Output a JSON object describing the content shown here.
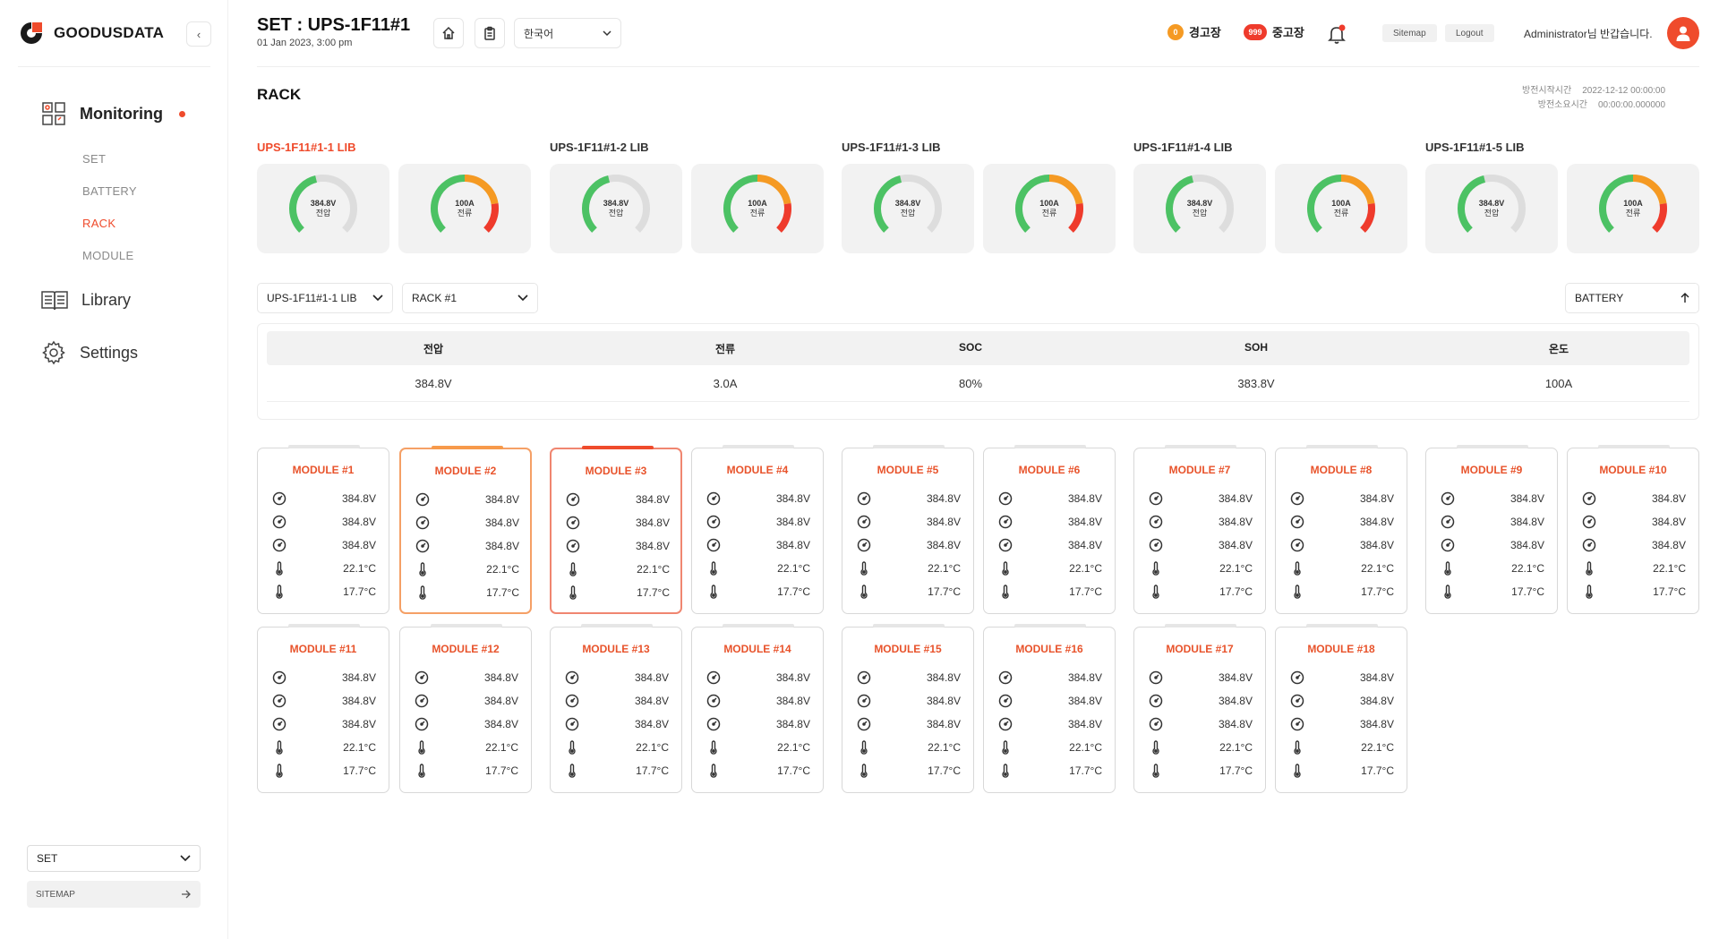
{
  "brand": {
    "name": "GOODUSDATA"
  },
  "sidebar": {
    "monitoring_label": "Monitoring",
    "sub_items": [
      {
        "label": "SET",
        "active": false
      },
      {
        "label": "BATTERY",
        "active": false
      },
      {
        "label": "RACK",
        "active": true
      },
      {
        "label": "MODULE",
        "active": false
      }
    ],
    "library_label": "Library",
    "settings_label": "Settings",
    "bottom_select": "SET",
    "sitemap_label": "SITEMAP"
  },
  "header": {
    "title": "SET : UPS-1F11#1",
    "date": "01 Jan 2023, 3:00 pm",
    "language": "한국어",
    "warning_count": "0",
    "warning_label": "경고장",
    "fault_count": "999",
    "fault_label": "중고장",
    "sitemap_btn": "Sitemap",
    "logout_btn": "Logout",
    "welcome": "Administrator님 반갑습니다."
  },
  "page": {
    "title": "RACK",
    "start_label": "방전시작시간",
    "start_value": "2022-12-12 00:00:00",
    "elapsed_label": "방전소요시간",
    "elapsed_value": "00:00:00.000000"
  },
  "colors": {
    "accent": "#ef4b2c",
    "gauge_green": "#4cc264",
    "gauge_orange": "#f59a23",
    "gauge_red": "#ef3b2c",
    "gauge_track": "#dddddd"
  },
  "libs": [
    {
      "name": "UPS-1F11#1-1 LIB",
      "active": true,
      "voltage": {
        "value": "384.8V",
        "label": "전압"
      },
      "current": {
        "value": "100A",
        "label": "전류"
      }
    },
    {
      "name": "UPS-1F11#1-2 LIB",
      "active": false,
      "voltage": {
        "value": "384.8V",
        "label": "전압"
      },
      "current": {
        "value": "100A",
        "label": "전류"
      }
    },
    {
      "name": "UPS-1F11#1-3 LIB",
      "active": false,
      "voltage": {
        "value": "384.8V",
        "label": "전압"
      },
      "current": {
        "value": "100A",
        "label": "전류"
      }
    },
    {
      "name": "UPS-1F11#1-4 LIB",
      "active": false,
      "voltage": {
        "value": "384.8V",
        "label": "전압"
      },
      "current": {
        "value": "100A",
        "label": "전류"
      }
    },
    {
      "name": "UPS-1F11#1-5 LIB",
      "active": false,
      "voltage": {
        "value": "384.8V",
        "label": "전압"
      },
      "current": {
        "value": "100A",
        "label": "전류"
      }
    }
  ],
  "selectors": {
    "lib": "UPS-1F11#1-1 LIB",
    "rack": "RACK #1",
    "battery": "BATTERY"
  },
  "summary": {
    "headers": [
      "전압",
      "전류",
      "SOC",
      "SOH",
      "온도"
    ],
    "values": [
      "384.8V",
      "3.0A",
      "80%",
      "383.8V",
      "100A"
    ]
  },
  "modules": [
    {
      "title": "MODULE #1",
      "state": "normal",
      "rows": [
        "384.8V",
        "384.8V",
        "384.8V",
        "22.1°C",
        "17.7°C"
      ]
    },
    {
      "title": "MODULE #2",
      "state": "warning",
      "rows": [
        "384.8V",
        "384.8V",
        "384.8V",
        "22.1°C",
        "17.7°C"
      ]
    },
    {
      "title": "MODULE #3",
      "state": "fault",
      "rows": [
        "384.8V",
        "384.8V",
        "384.8V",
        "22.1°C",
        "17.7°C"
      ]
    },
    {
      "title": "MODULE #4",
      "state": "normal",
      "rows": [
        "384.8V",
        "384.8V",
        "384.8V",
        "22.1°C",
        "17.7°C"
      ]
    },
    {
      "title": "MODULE #5",
      "state": "normal",
      "rows": [
        "384.8V",
        "384.8V",
        "384.8V",
        "22.1°C",
        "17.7°C"
      ]
    },
    {
      "title": "MODULE #6",
      "state": "normal",
      "rows": [
        "384.8V",
        "384.8V",
        "384.8V",
        "22.1°C",
        "17.7°C"
      ]
    },
    {
      "title": "MODULE #7",
      "state": "normal",
      "rows": [
        "384.8V",
        "384.8V",
        "384.8V",
        "22.1°C",
        "17.7°C"
      ]
    },
    {
      "title": "MODULE #8",
      "state": "normal",
      "rows": [
        "384.8V",
        "384.8V",
        "384.8V",
        "22.1°C",
        "17.7°C"
      ]
    },
    {
      "title": "MODULE #9",
      "state": "normal",
      "rows": [
        "384.8V",
        "384.8V",
        "384.8V",
        "22.1°C",
        "17.7°C"
      ]
    },
    {
      "title": "MODULE #10",
      "state": "normal",
      "rows": [
        "384.8V",
        "384.8V",
        "384.8V",
        "22.1°C",
        "17.7°C"
      ]
    },
    {
      "title": "MODULE #11",
      "state": "normal",
      "rows": [
        "384.8V",
        "384.8V",
        "384.8V",
        "22.1°C",
        "17.7°C"
      ]
    },
    {
      "title": "MODULE #12",
      "state": "normal",
      "rows": [
        "384.8V",
        "384.8V",
        "384.8V",
        "22.1°C",
        "17.7°C"
      ]
    },
    {
      "title": "MODULE #13",
      "state": "normal",
      "rows": [
        "384.8V",
        "384.8V",
        "384.8V",
        "22.1°C",
        "17.7°C"
      ]
    },
    {
      "title": "MODULE #14",
      "state": "normal",
      "rows": [
        "384.8V",
        "384.8V",
        "384.8V",
        "22.1°C",
        "17.7°C"
      ]
    },
    {
      "title": "MODULE #15",
      "state": "normal",
      "rows": [
        "384.8V",
        "384.8V",
        "384.8V",
        "22.1°C",
        "17.7°C"
      ]
    },
    {
      "title": "MODULE #16",
      "state": "normal",
      "rows": [
        "384.8V",
        "384.8V",
        "384.8V",
        "22.1°C",
        "17.7°C"
      ]
    },
    {
      "title": "MODULE #17",
      "state": "normal",
      "rows": [
        "384.8V",
        "384.8V",
        "384.8V",
        "22.1°C",
        "17.7°C"
      ]
    },
    {
      "title": "MODULE #18",
      "state": "normal",
      "rows": [
        "384.8V",
        "384.8V",
        "384.8V",
        "22.1°C",
        "17.7°C"
      ]
    }
  ],
  "module_row_icons": [
    "gauge-icon",
    "gauge-icon",
    "gauge-icon",
    "thermometer-icon",
    "thermometer-icon"
  ]
}
